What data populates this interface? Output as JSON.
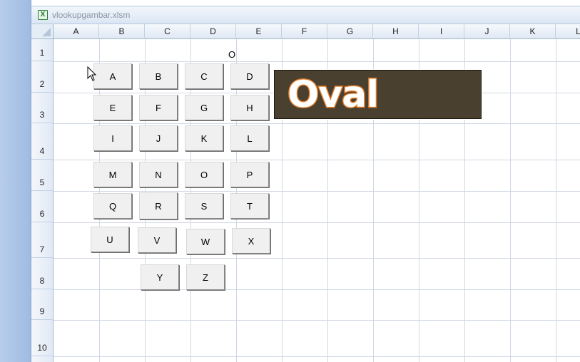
{
  "window": {
    "title": "vlookupgambar.xlsm",
    "file_icon": "excel-file-icon"
  },
  "columns": [
    "A",
    "B",
    "C",
    "D",
    "E",
    "F",
    "G",
    "H",
    "I",
    "J",
    "K",
    "L"
  ],
  "rows": [
    "1",
    "2",
    "3",
    "4",
    "5",
    "6",
    "7",
    "8",
    "9",
    "10"
  ],
  "cells": {
    "E1": "O"
  },
  "buttons": [
    "A",
    "B",
    "C",
    "D",
    "E",
    "F",
    "G",
    "H",
    "I",
    "J",
    "K",
    "L",
    "M",
    "N",
    "O",
    "P",
    "Q",
    "R",
    "S",
    "T",
    "U",
    "V",
    "W",
    "X",
    "Y",
    "Z"
  ],
  "banner": {
    "text": "Oval",
    "background": "#4a4030",
    "outline": "#e07a24"
  }
}
